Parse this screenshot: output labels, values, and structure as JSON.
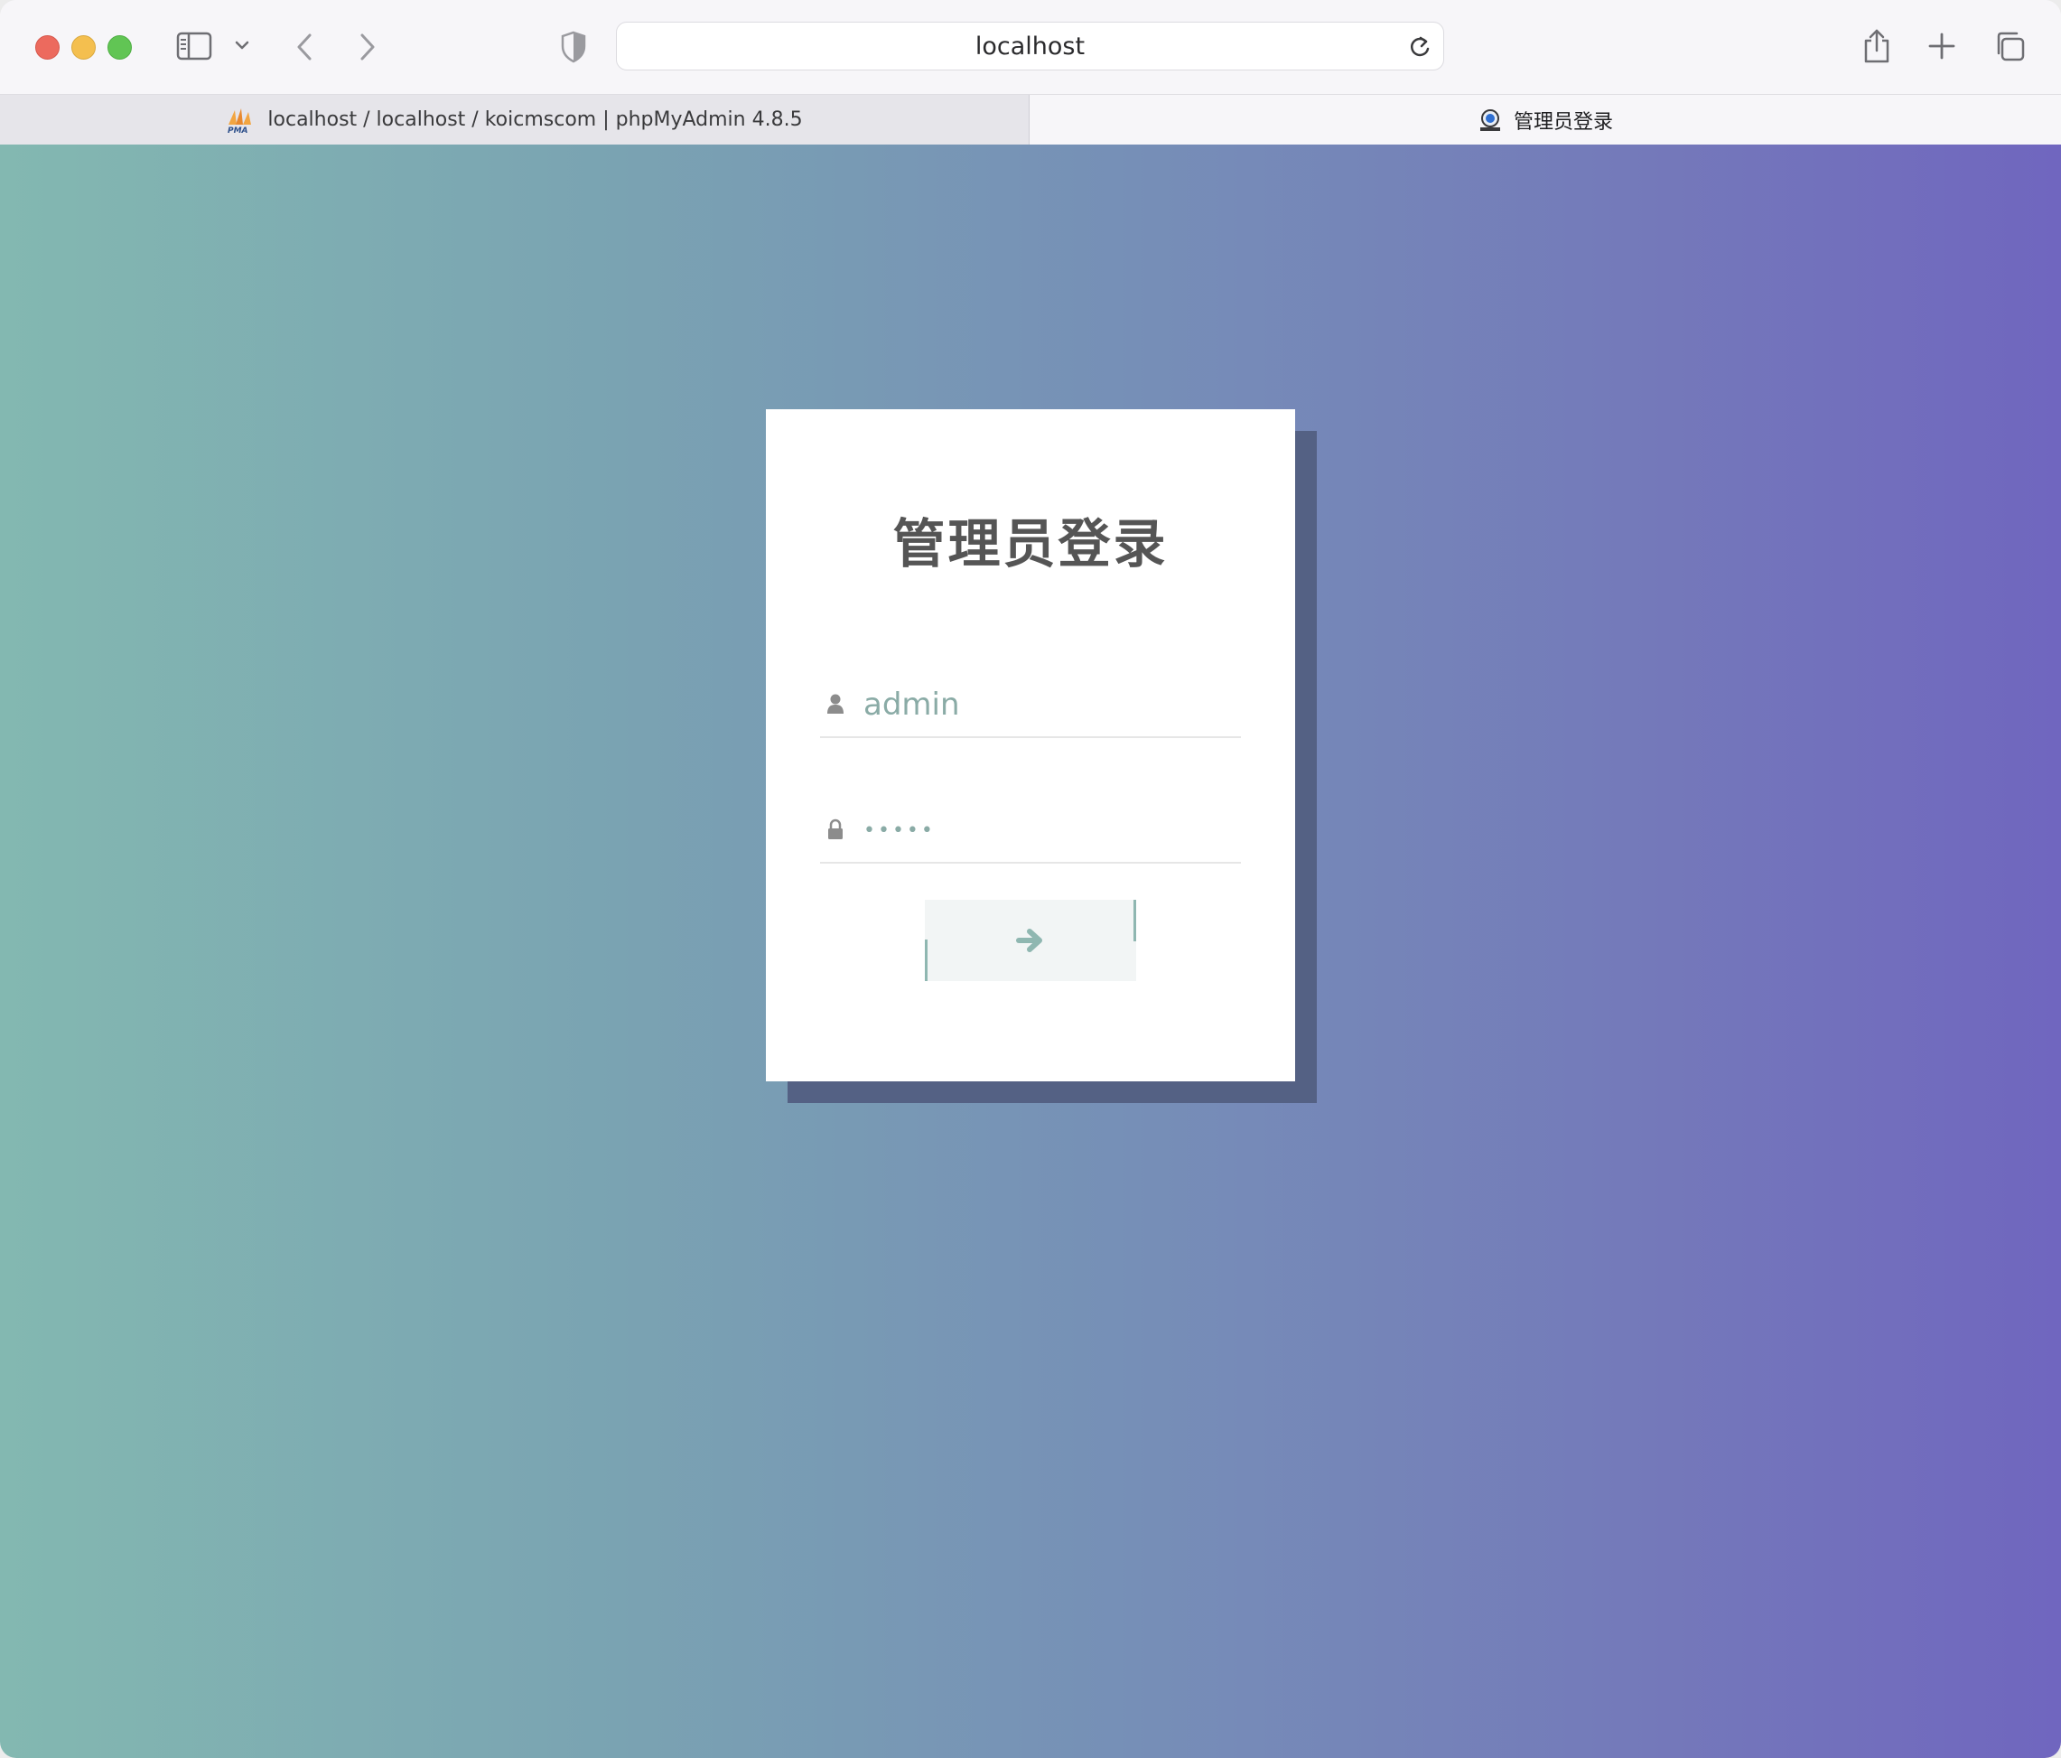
{
  "browser": {
    "address": "localhost",
    "tabs": [
      {
        "label": "localhost / localhost / koicmscom | phpMyAdmin 4.8.5",
        "icon": "phpmyadmin-icon",
        "active": false
      },
      {
        "label": "管理员登录",
        "icon": "site-favicon-icon",
        "active": true
      }
    ]
  },
  "login": {
    "title": "管理员登录",
    "username_value": "admin",
    "password_value": "•••••",
    "submit_icon": "arrow-right-icon"
  },
  "colors": {
    "gradient_start": "#83b8b1",
    "gradient_end": "#7066bf",
    "card_shadow": "#546184",
    "title": "#555555",
    "accent": "#8fb7b1"
  }
}
